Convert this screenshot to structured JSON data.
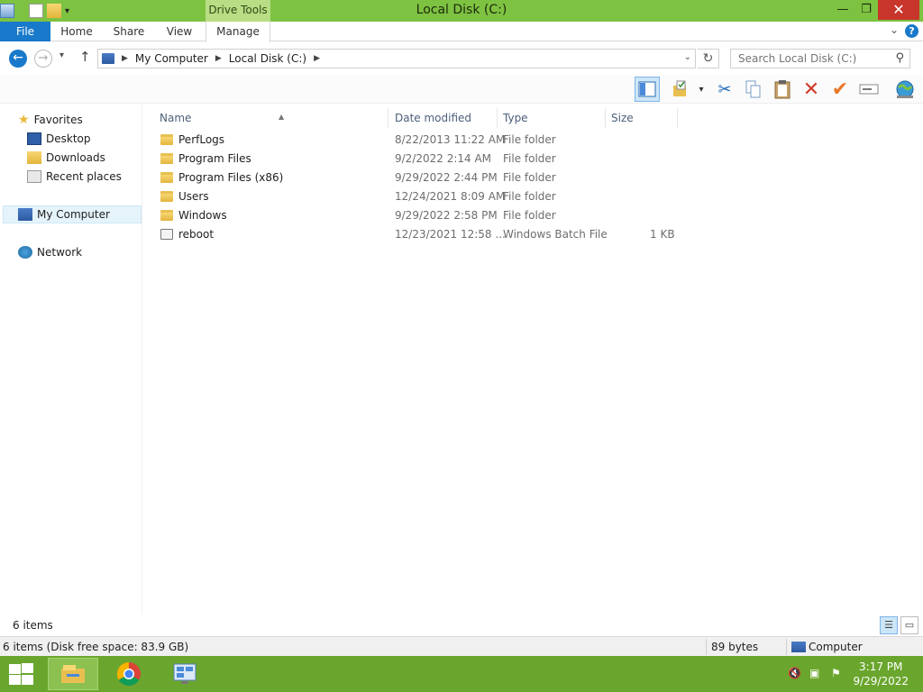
{
  "window": {
    "title": "Local Disk (C:)",
    "context_tab": "Drive Tools",
    "accent_color": "#7ec242"
  },
  "ribbon": {
    "tabs": [
      "File",
      "Home",
      "Share",
      "View",
      "Manage"
    ]
  },
  "address": {
    "crumbs": [
      "My Computer",
      "Local Disk (C:)"
    ],
    "search_placeholder": "Search Local Disk (C:)"
  },
  "toolbar": {
    "icons": [
      "preview-pane-icon",
      "folder-options-icon",
      "cut-icon",
      "copy-icon",
      "paste-icon",
      "delete-icon",
      "select-icon",
      "rename-icon",
      "network-globe-icon"
    ]
  },
  "nav": {
    "favorites": "Favorites",
    "items": [
      "Desktop",
      "Downloads",
      "Recent places"
    ],
    "computer": "My Computer",
    "network": "Network"
  },
  "columns": {
    "name": "Name",
    "date": "Date modified",
    "type": "Type",
    "size": "Size"
  },
  "files": [
    {
      "name": "PerfLogs",
      "date": "8/22/2013 11:22 AM",
      "type": "File folder",
      "size": "",
      "kind": "folder"
    },
    {
      "name": "Program Files",
      "date": "9/2/2022 2:14 AM",
      "type": "File folder",
      "size": "",
      "kind": "folder"
    },
    {
      "name": "Program Files (x86)",
      "date": "9/29/2022 2:44 PM",
      "type": "File folder",
      "size": "",
      "kind": "folder"
    },
    {
      "name": "Users",
      "date": "12/24/2021 8:09 AM",
      "type": "File folder",
      "size": "",
      "kind": "folder"
    },
    {
      "name": "Windows",
      "date": "9/29/2022 2:58 PM",
      "type": "File folder",
      "size": "",
      "kind": "folder"
    },
    {
      "name": "reboot",
      "date": "12/23/2021 12:58 ...",
      "type": "Windows Batch File",
      "size": "1 KB",
      "kind": "bat"
    }
  ],
  "status": {
    "item_count": "6 items",
    "details": "6 items (Disk free space: 83.9 GB)",
    "selection_size": "89 bytes",
    "location": "Computer"
  },
  "taskbar": {
    "time": "3:17 PM",
    "date": "9/29/2022"
  }
}
